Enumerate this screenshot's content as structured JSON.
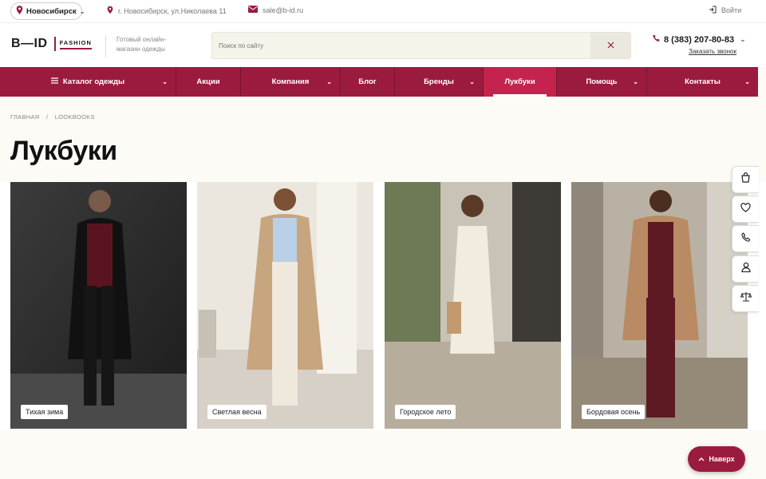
{
  "topbar": {
    "city": "Новосибирск",
    "address": "г. Новосибирск, ул.Николаева 11",
    "email": "sale@b-id.ru",
    "login": "Войти"
  },
  "header": {
    "logo_main": "B—ID",
    "logo_sub": "FASHION",
    "tagline": "Готовый онлайн-магазин одежды",
    "search_placeholder": "Поиск по сайту",
    "phone": "8 (383) 207-80-83",
    "callback": "Заказать звонок"
  },
  "nav": {
    "items": [
      {
        "label": "Каталог одежды"
      },
      {
        "label": "Акции"
      },
      {
        "label": "Компания"
      },
      {
        "label": "Блог"
      },
      {
        "label": "Бренды"
      },
      {
        "label": "Лукбуки"
      },
      {
        "label": "Помощь"
      },
      {
        "label": "Контакты"
      }
    ]
  },
  "breadcrumb": {
    "home": "ГЛАВНАЯ",
    "sep": "/",
    "current": "LOOKBOOKS"
  },
  "page_title": "Лукбуки",
  "cards": [
    {
      "label": "Тихая зима"
    },
    {
      "label": "Светлая весна"
    },
    {
      "label": "Городское лето"
    },
    {
      "label": "Бордовая осень"
    }
  ],
  "to_top": "Наверх",
  "colors": {
    "accent": "#9b1b3f",
    "active": "#c4234e",
    "background": "#fcfbf6"
  },
  "icons": [
    "location-pin-icon",
    "mail-icon",
    "login-icon",
    "phone-icon",
    "close-icon",
    "menu-icon",
    "cart-icon",
    "heart-icon",
    "phone-icon",
    "user-icon",
    "scales-icon",
    "chevron-up-icon"
  ]
}
